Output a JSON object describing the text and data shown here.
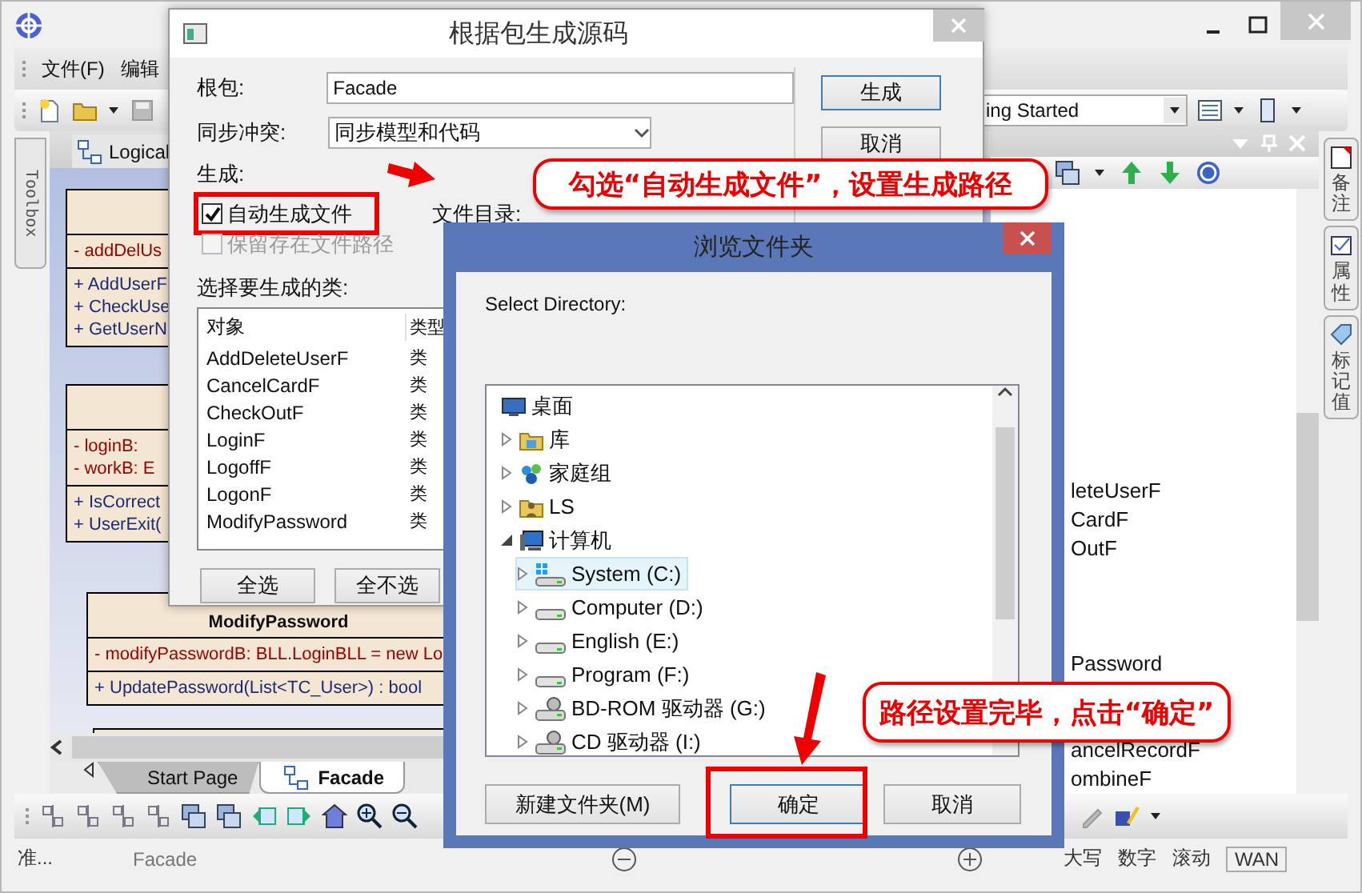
{
  "app": {
    "menu": [
      "文件(F)",
      "编辑"
    ],
    "perspective": "ing Started",
    "toolbox_label": "Toolbox",
    "diagram_tab": "Logical"
  },
  "classes": [
    {
      "attributes": [
        {
          "visibility": "-",
          "text": "addDelUs"
        }
      ],
      "operations": [
        {
          "visibility": "+",
          "text": "AddUserF"
        },
        {
          "visibility": "+",
          "text": "CheckUse"
        },
        {
          "visibility": "+",
          "text": "GetUserN"
        }
      ]
    },
    {
      "attributes": [
        {
          "visibility": "-",
          "text": "loginB:"
        },
        {
          "visibility": "-",
          "text": "workB:  E"
        }
      ],
      "operations": [
        {
          "visibility": "+",
          "text": "IsCorrect"
        },
        {
          "visibility": "+",
          "text": "UserExit("
        }
      ]
    },
    {
      "name": "ModifyPassword",
      "attributes": [
        {
          "visibility": "-",
          "text": "modifyPasswordB:  BLL.LoginBLL = new Lo"
        }
      ],
      "operations": [
        {
          "visibility": "+",
          "text": "UpdatePassword(List<TC_User>) : bool"
        }
      ]
    }
  ],
  "bottom_tabs": [
    {
      "label": "Start Page",
      "selected": false
    },
    {
      "label": "Facade",
      "selected": true
    }
  ],
  "right_panel": {
    "items": [
      "leteUserF",
      "CardF",
      "OutF",
      "Password",
      "ancelRecordF",
      "ombineF"
    ]
  },
  "side_tabs": [
    "备注",
    "属性",
    "标记值"
  ],
  "status_bar": {
    "left": [
      "准...",
      "Facade"
    ],
    "right": [
      "大写",
      "数字",
      "滚动",
      "WAN"
    ]
  },
  "dialog_generate": {
    "title": "根据包生成源码",
    "root_package_label": "根包:",
    "root_package": "Facade",
    "sync_label": "同步冲突:",
    "sync_value": "同步模型和代码",
    "generate_label": "生成:",
    "options": [
      {
        "label": "自动生成文件",
        "checked": true,
        "disabled": false
      },
      {
        "label": "保留存在文件路径",
        "checked": false,
        "disabled": true
      }
    ],
    "directory_label": "文件目录:",
    "classes_label": "选择要生成的类:",
    "columns": [
      "对象",
      "类型"
    ],
    "rows": [
      {
        "name": "AddDeleteUserF",
        "type": "类"
      },
      {
        "name": "CancelCardF",
        "type": "类"
      },
      {
        "name": "CheckOutF",
        "type": "类"
      },
      {
        "name": "LoginF",
        "type": "类"
      },
      {
        "name": "LogoffF",
        "type": "类"
      },
      {
        "name": "LogonF",
        "type": "类"
      },
      {
        "name": "ModifyPassword",
        "type": "类"
      }
    ],
    "buttons": [
      "生成",
      "取消"
    ],
    "list_buttons": [
      "全选",
      "全不选"
    ]
  },
  "dialog_browse": {
    "title": "浏览文件夹",
    "prompt": "Select Directory:",
    "tree": [
      {
        "label": "桌面",
        "kind": "desktop",
        "selected": false,
        "children": [
          {
            "label": "库",
            "kind": "library",
            "expanded": false,
            "selected": false
          },
          {
            "label": "家庭组",
            "kind": "homegroup",
            "expanded": false,
            "selected": false
          },
          {
            "label": "LS",
            "kind": "user",
            "expanded": false,
            "selected": false
          },
          {
            "label": "计算机",
            "kind": "computer",
            "expanded": true,
            "selected": false,
            "children": [
              {
                "label": "System (C:)",
                "kind": "system-drive",
                "expanded": false,
                "selected": true
              },
              {
                "label": "Computer (D:)",
                "kind": "drive",
                "expanded": false,
                "selected": false
              },
              {
                "label": "English (E:)",
                "kind": "drive",
                "expanded": false,
                "selected": false
              },
              {
                "label": "Program (F:)",
                "kind": "drive",
                "expanded": false,
                "selected": false
              },
              {
                "label": "BD-ROM 驱动器 (G:)",
                "kind": "optical",
                "expanded": false,
                "selected": false
              },
              {
                "label": "CD 驱动器 (I:)",
                "kind": "optical",
                "expanded": false,
                "selected": false
              }
            ]
          }
        ]
      }
    ],
    "buttons": [
      "新建文件夹(M)",
      "确定",
      "取消"
    ]
  },
  "callouts": [
    "勾选“自动生成文件”，设置生成路径",
    "路径设置完毕，点击“确定”"
  ]
}
